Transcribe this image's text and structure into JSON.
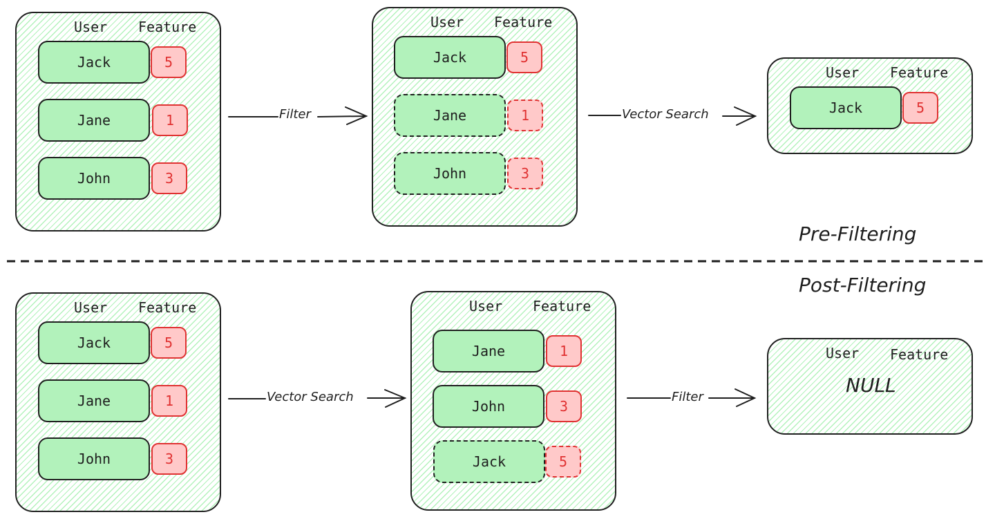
{
  "sections": {
    "pre_filtering_label": "Pre-Filtering",
    "post_filtering_label": "Post-Filtering"
  },
  "headers": {
    "user": "User",
    "feature": "Feature"
  },
  "pre": {
    "input": [
      {
        "user": "Jack",
        "feature": "5"
      },
      {
        "user": "Jane",
        "feature": "1"
      },
      {
        "user": "John",
        "feature": "3"
      }
    ],
    "step1_label": "Filter",
    "filtered": [
      {
        "user": "Jack",
        "feature": "5",
        "excluded": false
      },
      {
        "user": "Jane",
        "feature": "1",
        "excluded": true
      },
      {
        "user": "John",
        "feature": "3",
        "excluded": true
      }
    ],
    "step2_label": "Vector Search",
    "result": [
      {
        "user": "Jack",
        "feature": "5"
      }
    ]
  },
  "post": {
    "input": [
      {
        "user": "Jack",
        "feature": "5"
      },
      {
        "user": "Jane",
        "feature": "1"
      },
      {
        "user": "John",
        "feature": "3"
      }
    ],
    "step1_label": "Vector Search",
    "searched": [
      {
        "user": "Jane",
        "feature": "1",
        "excluded": false
      },
      {
        "user": "John",
        "feature": "3",
        "excluded": false
      },
      {
        "user": "Jack",
        "feature": "5",
        "excluded": true
      }
    ],
    "step2_label": "Filter",
    "result_text": "NULL"
  },
  "colors": {
    "user_fill": "#b2f2bb",
    "feature_fill": "#ffc9c9",
    "feature_stroke": "#e03131",
    "stroke": "#1e1e1e"
  }
}
